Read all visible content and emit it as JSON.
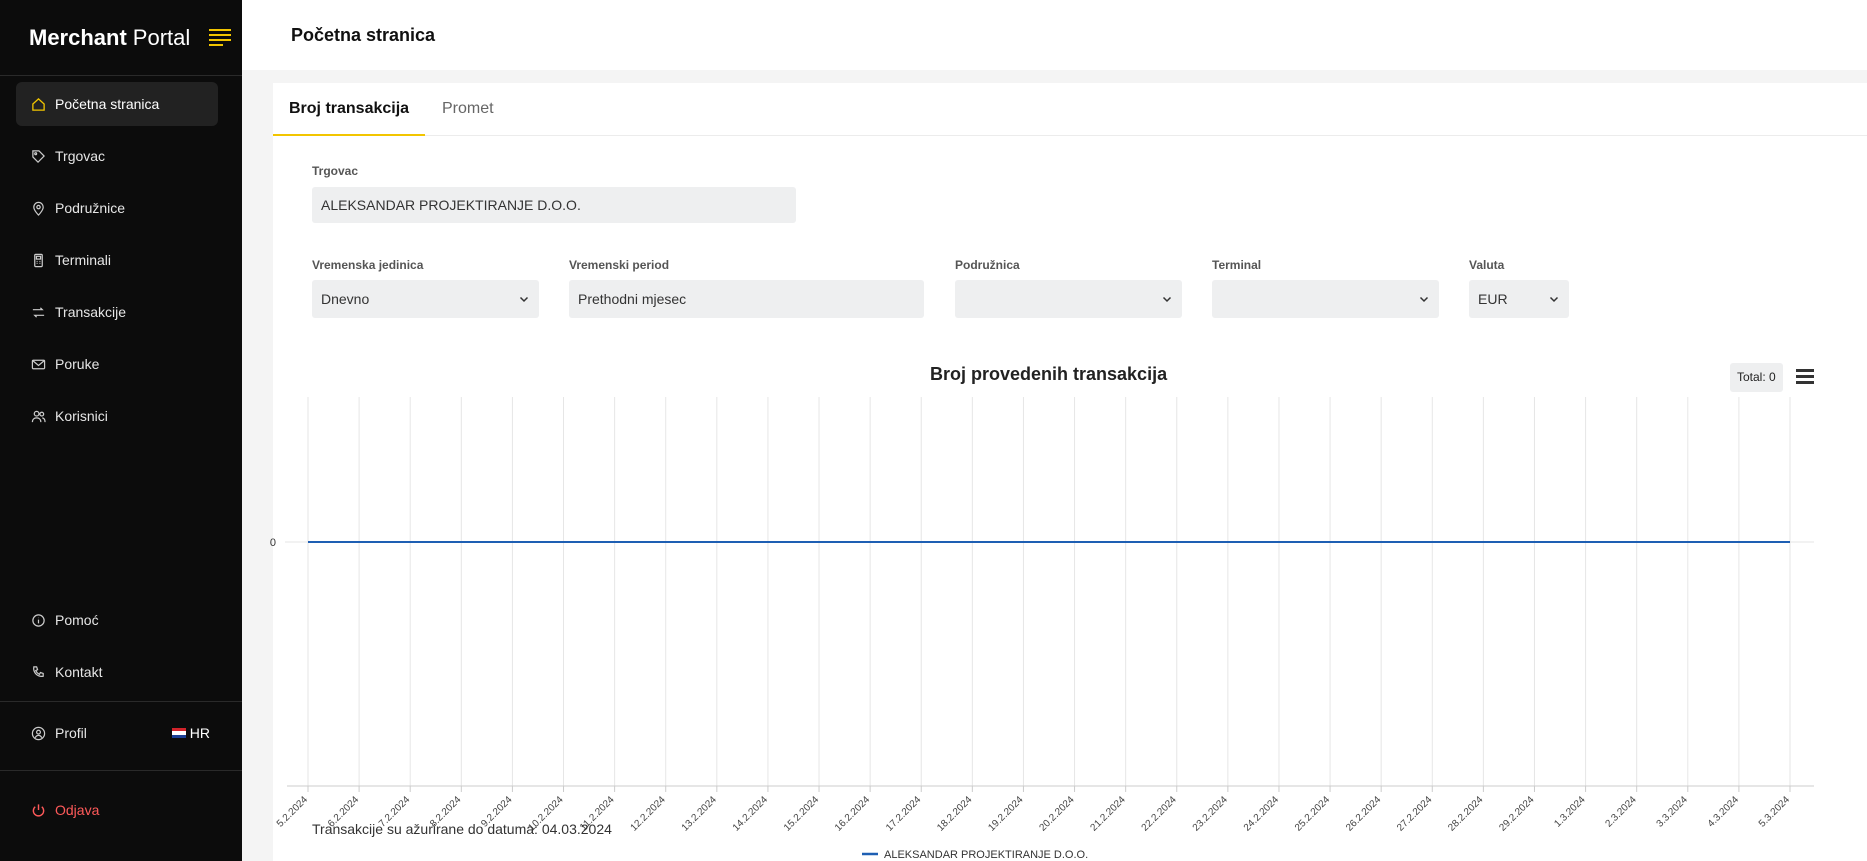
{
  "app": {
    "brand_bold": "Merchant",
    "brand_light": "Portal",
    "accent_color": "#f2c500",
    "danger_color": "#ff5a5a",
    "line_color": "#1e5fb3"
  },
  "sidebar": {
    "items": [
      {
        "label": "Početna stranica",
        "icon": "home-icon",
        "active": true
      },
      {
        "label": "Trgovac",
        "icon": "tag-icon",
        "active": false
      },
      {
        "label": "Podružnice",
        "icon": "location-pin-icon",
        "active": false
      },
      {
        "label": "Terminali",
        "icon": "terminal-device-icon",
        "active": false
      },
      {
        "label": "Transakcije",
        "icon": "transfer-arrows-icon",
        "active": false
      },
      {
        "label": "Poruke",
        "icon": "envelope-icon",
        "active": false
      },
      {
        "label": "Korisnici",
        "icon": "users-icon",
        "active": false
      }
    ],
    "help_label": "Pomoć",
    "contact_label": "Kontakt",
    "profile_label": "Profil",
    "language": "HR",
    "logout_label": "Odjava"
  },
  "header": {
    "title": "Početna stranica"
  },
  "tabs": [
    {
      "label": "Broj transakcija",
      "active": true
    },
    {
      "label": "Promet",
      "active": false
    }
  ],
  "filters": {
    "merchant_label": "Trgovac",
    "merchant_value": "ALEKSANDAR PROJEKTIRANJE D.O.O.",
    "time_unit_label": "Vremenska jedinica",
    "time_unit_value": "Dnevno",
    "period_label": "Vremenski period",
    "period_value": "Prethodni mjesec",
    "branch_label": "Podružnica",
    "branch_value": "",
    "terminal_label": "Terminal",
    "terminal_value": "",
    "currency_label": "Valuta",
    "currency_value": "EUR"
  },
  "chart_data": {
    "type": "line",
    "title": "Broj provedenih transakcija",
    "total_label": "Total: 0",
    "x": [
      "5.2.2024",
      "6.2.2024",
      "7.2.2024",
      "8.2.2024",
      "9.2.2024",
      "10.2.2024",
      "11.2.2024",
      "12.2.2024",
      "13.2.2024",
      "14.2.2024",
      "15.2.2024",
      "16.2.2024",
      "17.2.2024",
      "18.2.2024",
      "19.2.2024",
      "20.2.2024",
      "21.2.2024",
      "22.2.2024",
      "23.2.2024",
      "24.2.2024",
      "25.2.2024",
      "26.2.2024",
      "27.2.2024",
      "28.2.2024",
      "29.2.2024",
      "1.3.2024",
      "2.3.2024",
      "3.3.2024",
      "4.3.2024",
      "5.3.2024"
    ],
    "y_ticks": [
      "0"
    ],
    "series": [
      {
        "name": "ALEKSANDAR PROJEKTIRANJE D.O.O.",
        "values": [
          0,
          0,
          0,
          0,
          0,
          0,
          0,
          0,
          0,
          0,
          0,
          0,
          0,
          0,
          0,
          0,
          0,
          0,
          0,
          0,
          0,
          0,
          0,
          0,
          0,
          0,
          0,
          0,
          0,
          0
        ]
      }
    ],
    "grid": "vertical",
    "legend": "bottom-center"
  },
  "footer": {
    "note": "Transakcije su ažurirane do datuma: 04.03.2024"
  }
}
